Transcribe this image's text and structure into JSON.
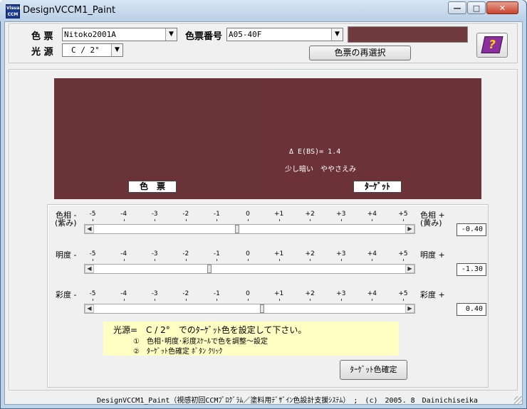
{
  "window": {
    "title": "DesignVCCM1_Paint",
    "icon_text": "Visual CCM",
    "controls": {
      "minimize": "—",
      "maximize": "□",
      "close": "✕"
    }
  },
  "header": {
    "color_chip_label": "色 票",
    "color_chip_value": "Nitoko2001A",
    "chip_number_label": "色票番号",
    "chip_number_value": "A05-40F",
    "illuminant_label": "光 源",
    "illuminant_value": "C / 2°",
    "reselect_button": "色票の再選択",
    "help_icon_glyph": "?"
  },
  "colors": {
    "standard": "#6a3338",
    "target": "#6b3337",
    "header_swatch": "#6f3a3d",
    "hint_bg": "#ffffc4",
    "help_book": "#8b2e9e"
  },
  "compare": {
    "delta_e_text": "Δ E(BS)= 1.4",
    "description": "少し暗い　ややさえみ",
    "standard_label": "色　票",
    "target_label": "ﾀｰｹﾞｯﾄ"
  },
  "scale_ticks": [
    "-5",
    "-4",
    "-3",
    "-2",
    "-1",
    "0",
    "+1",
    "+2",
    "+3",
    "+4",
    "+5"
  ],
  "sliders": [
    {
      "left_label_1": "色相 -",
      "left_label_2": "(紫み)",
      "right_label_1": "色相 +",
      "right_label_2": "(黄み)",
      "value": "-0.40",
      "level": -0.4
    },
    {
      "left_label_1": "明度 -",
      "left_label_2": "",
      "right_label_1": "明度 +",
      "right_label_2": "",
      "value": "-1.30",
      "level": -1.3
    },
    {
      "left_label_1": "彩度 -",
      "left_label_2": "",
      "right_label_1": "彩度 +",
      "right_label_2": "",
      "value": "0.40",
      "level": 0.4
    }
  ],
  "hint": {
    "line1": "光源=　C / 2°　でのﾀｰｹﾞｯﾄ色を設定して下さい。",
    "line2": "①　色相･明度･彩度ｽｹｰﾙで色を調整～設定",
    "line3": "②　ﾀｰｹﾞｯﾄ色確定 ﾎﾞﾀﾝ ｸﾘｯｸ"
  },
  "confirm_button": "ﾀｰｹﾞｯﾄ色確定",
  "status_bar": "DesignVCCM1_Paint（視感初回CCMﾌﾟﾛｸﾞﾗﾑ／塗料用ﾃﾞｻﾞｲﾝ色設計支援ｼｽﾃﾑ）　;　(c)　2005. 8　Dainichiseika"
}
